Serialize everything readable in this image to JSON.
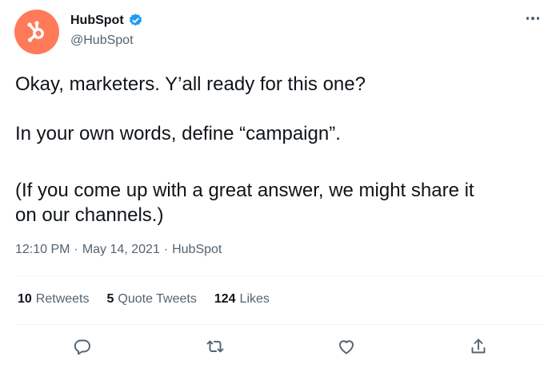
{
  "author": {
    "display_name": "HubSpot",
    "handle": "@HubSpot",
    "verified": true,
    "avatar_icon": "hubspot-sprocket-logo",
    "avatar_color": "#ff7a59",
    "verified_color": "#1d9bf0"
  },
  "tweet": {
    "line1": "Okay, marketers. Y’all ready for this one?",
    "line2": "In your own words, define “campaign”.",
    "line3a": "(If you come up with a great answer, we might share it",
    "line3b": "on our channels.)"
  },
  "meta": {
    "time": "12:10 PM",
    "separator1": "·",
    "date": "May 14, 2021",
    "separator2": "·",
    "source": "HubSpot"
  },
  "stats": {
    "retweets_count": "10",
    "retweets_label": "Retweets",
    "quotes_count": "5",
    "quotes_label": "Quote Tweets",
    "likes_count": "124",
    "likes_label": "Likes"
  },
  "actions": {
    "icons": [
      "reply-icon",
      "retweet-icon",
      "like-icon",
      "share-icon"
    ],
    "icon_color": "#536471"
  },
  "more_icon": "more-options-icon"
}
